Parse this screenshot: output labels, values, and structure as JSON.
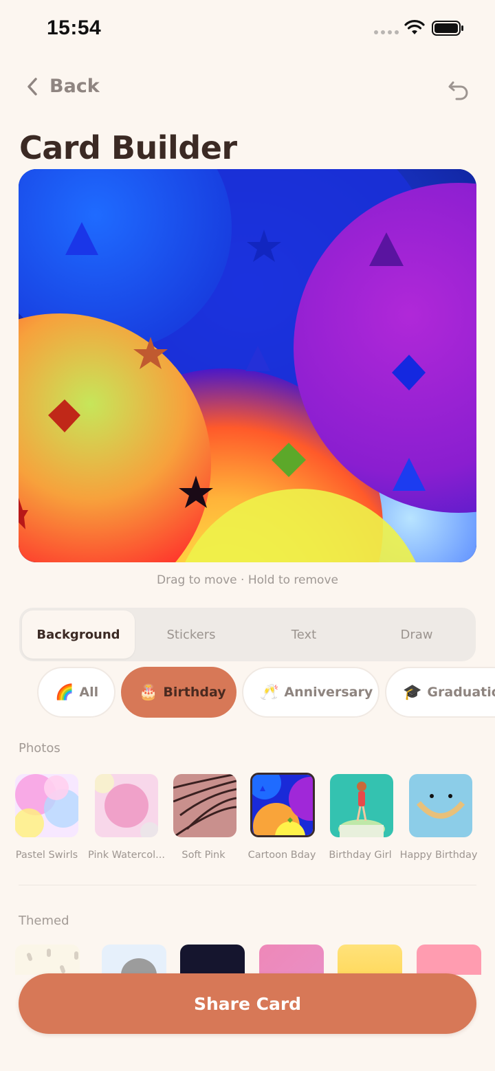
{
  "status_bar": {
    "time": "15:54"
  },
  "nav": {
    "back_label": "Back"
  },
  "page": {
    "title": "Card Builder"
  },
  "canvas": {
    "hint": "Drag to move · Hold to remove"
  },
  "tabs": [
    {
      "label": "Background",
      "active": true
    },
    {
      "label": "Stickers"
    },
    {
      "label": "Text"
    },
    {
      "label": "Draw"
    }
  ],
  "categories": [
    {
      "emoji": "🌈",
      "label": "All"
    },
    {
      "emoji": "🎂",
      "label": "Birthday",
      "selected": true
    },
    {
      "emoji": "🥂",
      "label": "Anniversary"
    },
    {
      "emoji": "🎓",
      "label": "Graduation"
    }
  ],
  "photos": {
    "heading": "Photos",
    "items": [
      {
        "label": "Pastel Swirls"
      },
      {
        "label": "Pink Watercol..."
      },
      {
        "label": "Soft Pink"
      },
      {
        "label": "Cartoon Bday",
        "selected": true
      },
      {
        "label": "Birthday Girl"
      },
      {
        "label": "Happy Birthday"
      }
    ]
  },
  "themed": {
    "heading": "Themed"
  },
  "actions": {
    "share_label": "Share Card"
  },
  "colors": {
    "accent": "#d77857",
    "background": "#fcf6f0",
    "text": "#3b2a24"
  }
}
